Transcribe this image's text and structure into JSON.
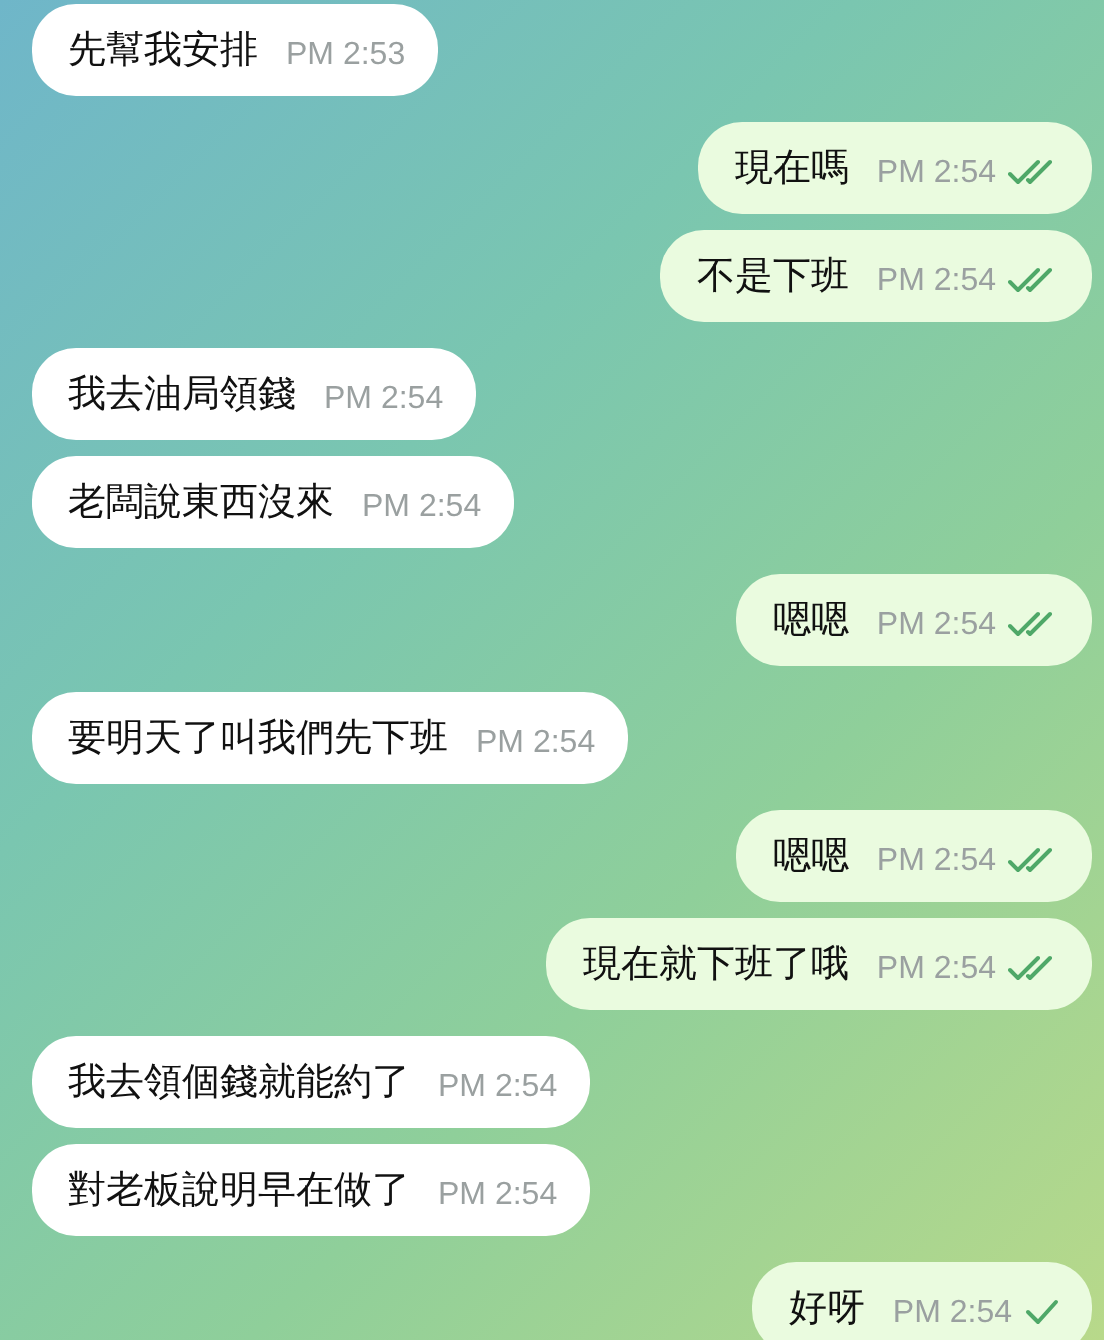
{
  "messages": [
    {
      "kind": "incoming",
      "text": "先幫我安排",
      "time": "PM 2:53"
    },
    {
      "kind": "outgoing",
      "text": "現在嗎",
      "time": "PM 2:54",
      "read": true
    },
    {
      "kind": "outgoing",
      "text": "不是下班",
      "time": "PM 2:54",
      "read": true
    },
    {
      "kind": "incoming",
      "text": "我去油局領錢",
      "time": "PM 2:54"
    },
    {
      "kind": "incoming",
      "text": "老闆說東西沒來",
      "time": "PM 2:54"
    },
    {
      "kind": "outgoing",
      "text": "嗯嗯",
      "time": "PM 2:54",
      "read": true
    },
    {
      "kind": "incoming",
      "text": "要明天了叫我們先下班",
      "time": "PM 2:54"
    },
    {
      "kind": "outgoing",
      "text": "嗯嗯",
      "time": "PM 2:54",
      "read": true
    },
    {
      "kind": "outgoing",
      "text": "現在就下班了哦",
      "time": "PM 2:54",
      "read": true
    },
    {
      "kind": "incoming",
      "text": "我去領個錢就能約了",
      "time": "PM 2:54"
    },
    {
      "kind": "incoming",
      "text": "對老板說明早在做了",
      "time": "PM 2:54"
    },
    {
      "kind": "outgoing",
      "text": "好呀",
      "time": "PM 2:54",
      "read": false
    }
  ]
}
